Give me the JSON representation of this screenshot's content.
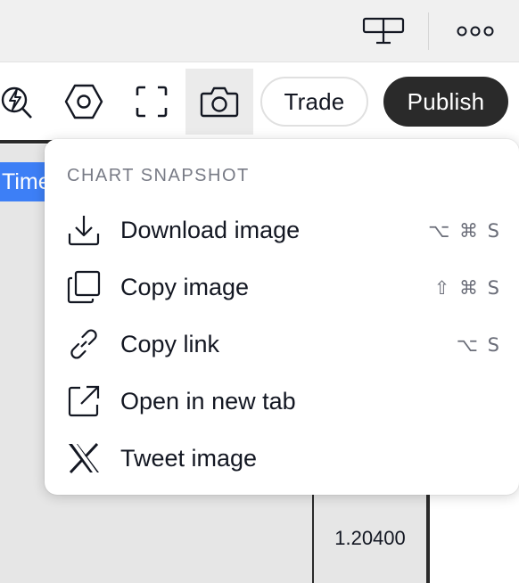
{
  "toolbar": {
    "tools": [
      {
        "name": "lightning-search-icon"
      },
      {
        "name": "hexagon-settings-icon"
      },
      {
        "name": "fullscreen-icon"
      },
      {
        "name": "camera-icon",
        "active": true
      }
    ],
    "trade_label": "Trade",
    "publish_label": "Publish"
  },
  "topbar": {
    "icons": [
      "layout-icon",
      "more-icon"
    ]
  },
  "chart": {
    "time_chip": "Time",
    "price_label": "1.20400"
  },
  "menu": {
    "header": "CHART SNAPSHOT",
    "items": [
      {
        "label": "Download image",
        "shortcut": "⌥ ⌘ S",
        "icon": "download-icon"
      },
      {
        "label": "Copy image",
        "shortcut": "⇧ ⌘ S",
        "icon": "copy-icon"
      },
      {
        "label": "Copy link",
        "shortcut": "⌥ S",
        "icon": "link-icon"
      },
      {
        "label": "Open in new tab",
        "shortcut": "",
        "icon": "external-link-icon"
      },
      {
        "label": "Tweet image",
        "shortcut": "",
        "icon": "x-logo-icon"
      }
    ]
  },
  "colors": {
    "accent_blue": "#3d7ff6",
    "publish_bg": "#2a2a2a",
    "text": "#131722",
    "muted": "#787b86"
  }
}
